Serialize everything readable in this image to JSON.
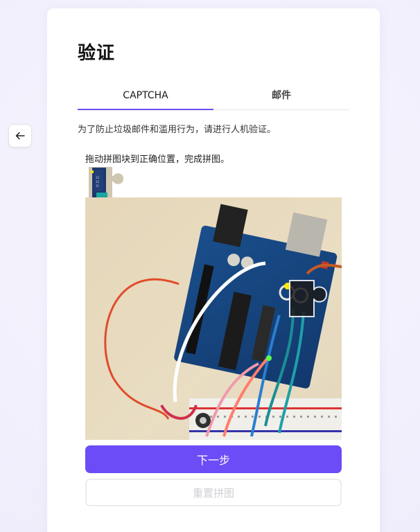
{
  "nav": {
    "back_icon": "arrow-left-icon"
  },
  "card": {
    "title": "验证",
    "tabs": [
      {
        "label": "CAPTCHA",
        "active": true
      },
      {
        "label": "邮件",
        "active": false
      }
    ],
    "description": "为了防止垃圾邮件和滥用行为，请进行人机验证。",
    "puzzle": {
      "instruction": "拖动拼图块到正确位置，完成拼图。",
      "image_subject": "arduino-board-photo"
    },
    "next_button": "下一步",
    "reset_button": "重置拼图"
  },
  "colors": {
    "accent": "#6c4cf7",
    "tab_underline": "#6a4cf5",
    "background": "#f2f0fb",
    "disabled_text": "#cfcfd4"
  }
}
